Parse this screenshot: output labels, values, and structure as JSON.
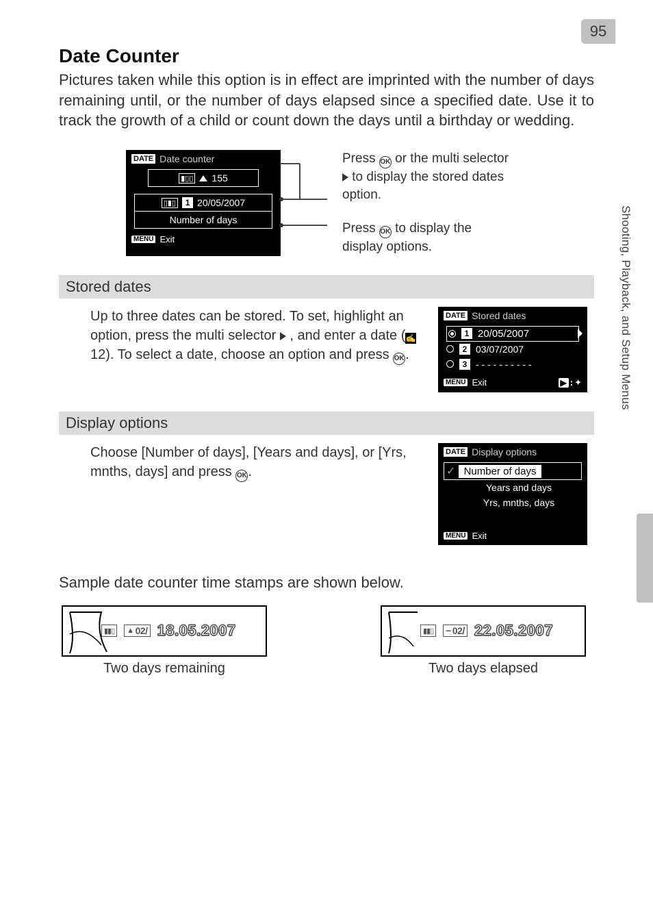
{
  "page_number": "95",
  "heading": "Date Counter",
  "intro": "Pictures taken while this option is in effect are imprinted with the number of days remaining until, or the number of days elapsed since a specified date. Use it to track the growth of a child or count down the days until a birthday or wedding.",
  "main_lcd": {
    "title": "Date counter",
    "icon": "DATE",
    "counter_value": "155",
    "date_badge": "1",
    "date_value": "20/05/2007",
    "link_label": "Number of days",
    "exit_badge": "MENU",
    "exit_label": "Exit"
  },
  "callout_top_a": "Press ",
  "callout_top_b": " or the multi selector ",
  "callout_top_c": "  to display the stored dates option.",
  "callout_bottom_a": "Press ",
  "callout_bottom_b": " to display the display options.",
  "stored": {
    "header": "Stored dates",
    "para_a": "Up to three dates can be stored. To set, highlight an option, press the multi selector ",
    "para_b": " , and enter a date (",
    "para_ref": " 12",
    "para_c": "). To select a date, choose an option and press ",
    "para_d": ".",
    "lcd": {
      "title": "Stored dates",
      "icon": "DATE",
      "rows": [
        {
          "n": "1",
          "val": "20/05/2007",
          "sel": true
        },
        {
          "n": "2",
          "val": "03/07/2007",
          "sel": false
        },
        {
          "n": "3",
          "val": "- - - - - - - - - -",
          "sel": false
        }
      ],
      "exit_badge": "MENU",
      "exit_label": "Exit",
      "right_icon": "▶",
      "right_icon2": "✦"
    }
  },
  "display": {
    "header": "Display options",
    "para_a": "Choose [Number of days], [Years and days], or [Yrs, mnths, days] and press ",
    "para_b": ".",
    "lcd": {
      "title": "Display options",
      "icon": "DATE",
      "opts": [
        "Number of days",
        "Years and days",
        "Yrs, mnths, days"
      ],
      "exit_badge": "MENU",
      "exit_label": "Exit"
    }
  },
  "sample_intro": "Sample date counter time stamps are shown below.",
  "samples": {
    "left": {
      "icon": "▲",
      "count": "02/",
      "date": "18.05.2007",
      "caption": "Two days remaining"
    },
    "right": {
      "icon": "−",
      "count": "02/",
      "date": "22.05.2007",
      "caption": "Two days elapsed"
    }
  },
  "side_text": "Shooting, Playback, and Setup Menus"
}
